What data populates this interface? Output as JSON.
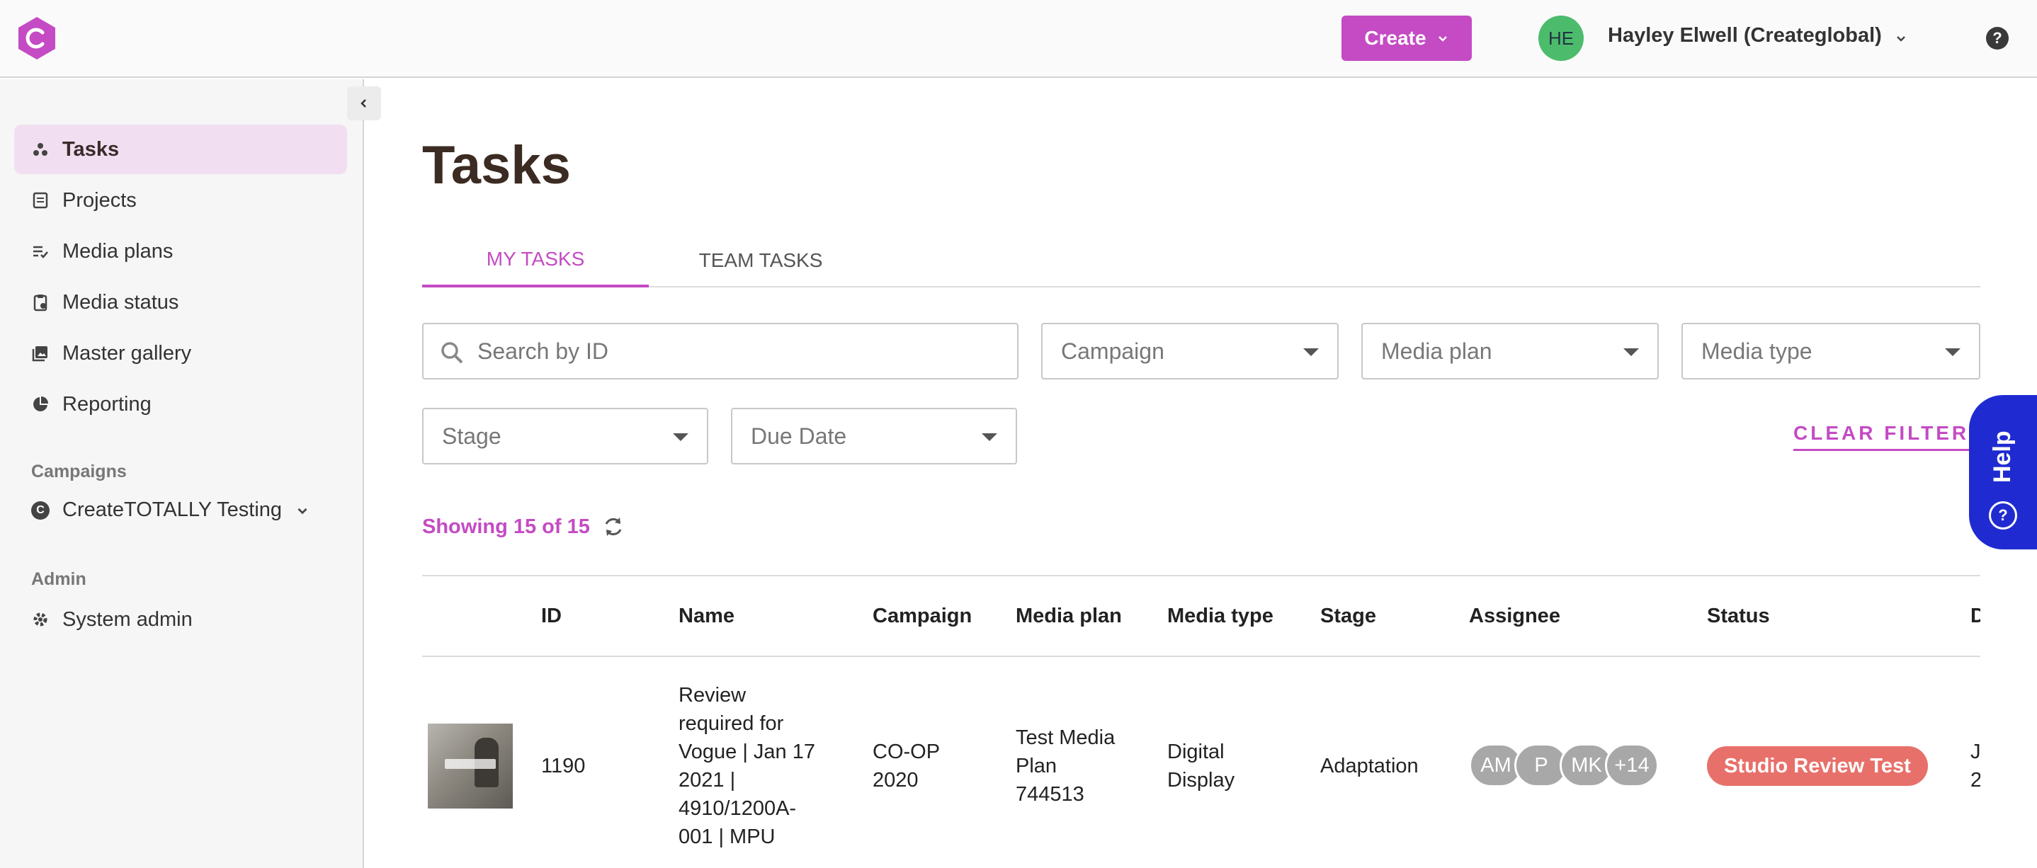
{
  "topbar": {
    "logo_icon": "createtotally-logo-icon",
    "create_label": "Create",
    "user_initials": "HE",
    "user_name": "Hayley Elwell (Createglobal)",
    "help_icon": "question-circle-icon"
  },
  "sidebar": {
    "nav": [
      {
        "label": "Tasks",
        "icon": "tasks-icon",
        "active": true
      },
      {
        "label": "Projects",
        "icon": "document-icon"
      },
      {
        "label": "Media plans",
        "icon": "list-check-icon"
      },
      {
        "label": "Media status",
        "icon": "clipboard-icon"
      },
      {
        "label": "Master gallery",
        "icon": "gallery-icon"
      },
      {
        "label": "Reporting",
        "icon": "pie-chart-icon"
      }
    ],
    "campaigns_label": "Campaigns",
    "campaign": {
      "initial": "C",
      "name": "CreateTOTALLY Testing"
    },
    "admin_label": "Admin",
    "admin_item": "System admin"
  },
  "main": {
    "title": "Tasks",
    "tabs": [
      {
        "label": "MY TASKS",
        "active": true
      },
      {
        "label": "TEAM TASKS"
      }
    ],
    "filters": {
      "search_placeholder": "Search by ID",
      "campaign": "Campaign",
      "media_plan": "Media plan",
      "media_type": "Media type",
      "stage": "Stage",
      "due_date": "Due Date",
      "clear_label": "CLEAR FILTERS"
    },
    "help_label": "Help",
    "showing": "Showing 15 of 15",
    "table": {
      "columns": [
        "ID",
        "Name",
        "Campaign",
        "Media plan",
        "Media type",
        "Stage",
        "Assignee",
        "Status",
        "D"
      ],
      "rows": [
        {
          "id": "1190",
          "name_lines": [
            "Review",
            "required for",
            "Vogue | Jan 17",
            "2021 |",
            "4910/1200A-",
            "001 | MPU"
          ],
          "campaign_lines": [
            "CO-OP",
            "2020"
          ],
          "media_plan_lines": [
            "Test Media",
            "Plan",
            "744513"
          ],
          "media_type_lines": [
            "Digital",
            "Display"
          ],
          "stage": "Adaptation",
          "assignees": [
            "AM",
            "P",
            "MK",
            "+14"
          ],
          "status": "Studio Review Test",
          "status_color": "#e8706a",
          "due_lines": [
            "J",
            "2"
          ]
        }
      ]
    }
  },
  "colors": {
    "accent": "#c44bc4",
    "help": "#1f2bd0",
    "avatar": "#4cbc6c"
  }
}
